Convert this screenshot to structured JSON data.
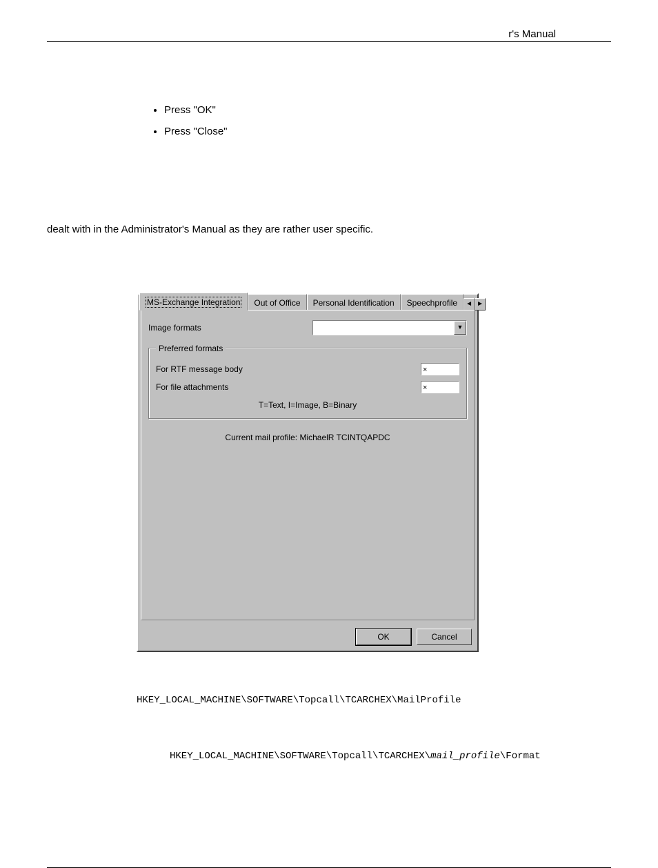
{
  "header": {
    "running_title": "r's Manual"
  },
  "bullets": [
    "Press \"OK\"",
    "Press \"Close\""
  ],
  "paragraph": "dealt with in the Administrator's Manual as they are rather user specific.",
  "dialog": {
    "tabs": [
      "MS-Exchange Integration",
      "Out of Office",
      "Personal Identification",
      "Speechprofile"
    ],
    "active_tab_index": 0,
    "nav_left": "◄",
    "nav_right": "►",
    "labels": {
      "image_formats": "Image formats",
      "group_title": "Preferred formats",
      "rtf_body": "For RTF message body",
      "file_att": "For file attachments",
      "legend_hint": "T=Text, I=Image, B=Binary",
      "profile_line": "Current mail profile: MichaelR TCINTQAPDC"
    },
    "fields": {
      "image_formats_value": "",
      "rtf_value": "×",
      "att_value": "×"
    },
    "buttons": {
      "ok": "OK",
      "cancel": "Cancel"
    },
    "combo_arrow": "▼"
  },
  "registry": {
    "line1": "HKEY_LOCAL_MACHINE\\SOFTWARE\\Topcall\\TCARCHEX\\MailProfile",
    "line2_pre": "HKEY_LOCAL_MACHINE\\SOFTWARE\\Topcall\\TCARCHEX\\",
    "line2_ital": "mail_profile",
    "line2_post": "\\Format"
  }
}
